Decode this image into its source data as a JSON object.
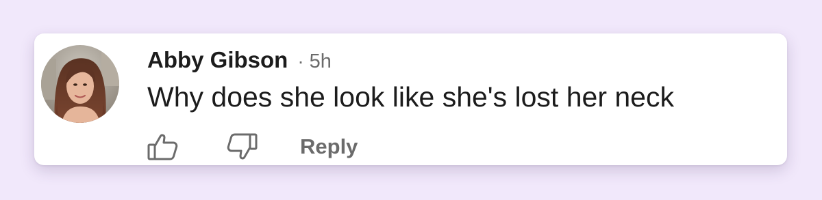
{
  "colors": {
    "page_background": "#f1e8fb",
    "text_primary": "#1c1c1c",
    "text_secondary": "#6b6b6b",
    "icon_color": "#6b6b6b"
  },
  "comment": {
    "author": "Abby Gibson",
    "separator": "·",
    "time": "5h",
    "text": "Why does she look like she's lost her neck"
  },
  "actions": {
    "like_icon": "thumbs-up-icon",
    "dislike_icon": "thumbs-down-icon",
    "reply_label": "Reply"
  }
}
